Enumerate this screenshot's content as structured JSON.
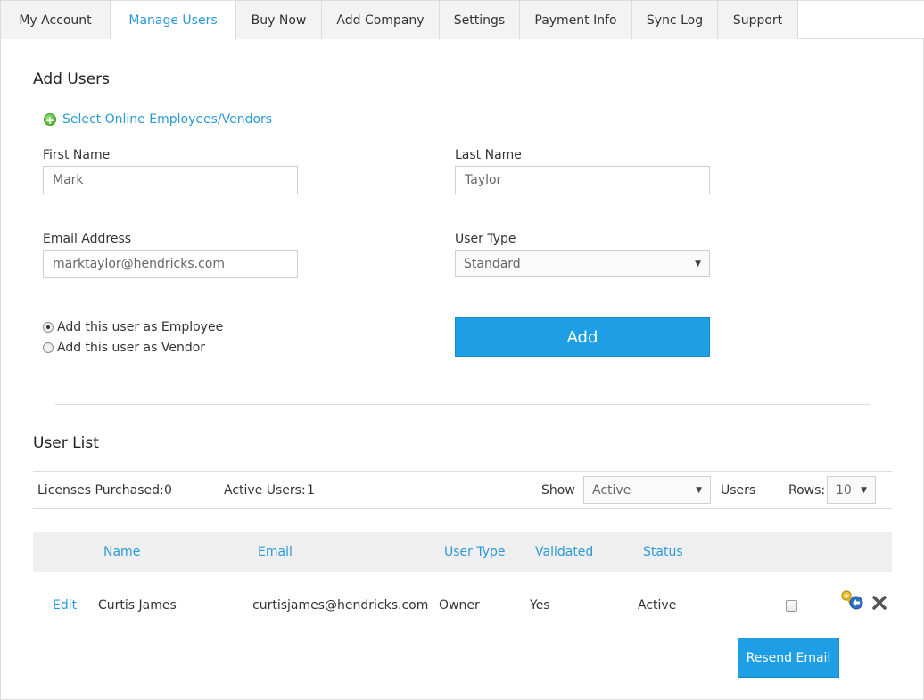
{
  "tabs": [
    {
      "label": "My Account"
    },
    {
      "label": "Manage Users"
    },
    {
      "label": "Buy Now"
    },
    {
      "label": "Add Company"
    },
    {
      "label": "Settings"
    },
    {
      "label": "Payment Info"
    },
    {
      "label": "Sync Log"
    },
    {
      "label": "Support"
    }
  ],
  "active_tab": "Manage Users",
  "add_users": {
    "title": "Add Users",
    "select_link": "Select Online Employees/Vendors",
    "first_name_label": "First Name",
    "first_name_value": "Mark",
    "last_name_label": "Last Name",
    "last_name_value": "Taylor",
    "email_label": "Email Address",
    "email_value": "marktaylor@hendricks.com",
    "user_type_label": "User Type",
    "user_type_value": "Standard",
    "radio_employee": "Add this user as Employee",
    "radio_vendor": "Add this user as Vendor",
    "radio_selected": "employee",
    "add_button": "Add"
  },
  "user_list": {
    "title": "User List",
    "licenses_label": "Licenses Purchased:",
    "licenses_value": "0",
    "active_users_label": "Active Users:",
    "active_users_value": "1",
    "show_label": "Show",
    "show_value": "Active",
    "users_label": "Users",
    "rows_label": "Rows:",
    "rows_value": "10",
    "columns": [
      "Name",
      "Email",
      "User Type",
      "Validated",
      "Status"
    ],
    "rows": [
      {
        "edit": "Edit",
        "name": "Curtis James",
        "email": "curtisjames@hendricks.com",
        "user_type": "Owner",
        "validated": "Yes",
        "status": "Active"
      }
    ],
    "resend_button": "Resend Email"
  },
  "colors": {
    "accent": "#1e9ee4",
    "link": "#2a9ad6"
  }
}
